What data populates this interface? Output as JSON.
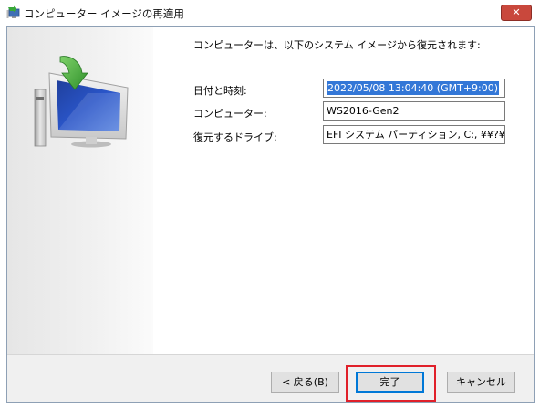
{
  "window": {
    "title": "コンピューター イメージの再適用",
    "close_glyph": "✕"
  },
  "main": {
    "heading": "コンピューターは、以下のシステム イメージから復元されます:",
    "fields": [
      {
        "label": "日付と時刻:",
        "value": "2022/05/08 13:04:40 (GMT+9:00)",
        "selected": true
      },
      {
        "label": "コンピューター:",
        "value": "WS2016-Gen2",
        "selected": false
      },
      {
        "label": "復元するドライブ:",
        "value": "EFI システム パーティション, C:, ¥¥?¥Volume",
        "selected": false
      }
    ]
  },
  "footer": {
    "back_label": "< 戻る(B)",
    "finish_label": "完了",
    "cancel_label": "キャンセル"
  },
  "colors": {
    "close_button": "#c9483c",
    "selection": "#3377d7",
    "highlight_box": "#e0202a",
    "footer_bg": "#f0f0f0"
  },
  "icons": {
    "title": "restore-computer-icon",
    "hero": "computer-restore-arrow-icon"
  }
}
